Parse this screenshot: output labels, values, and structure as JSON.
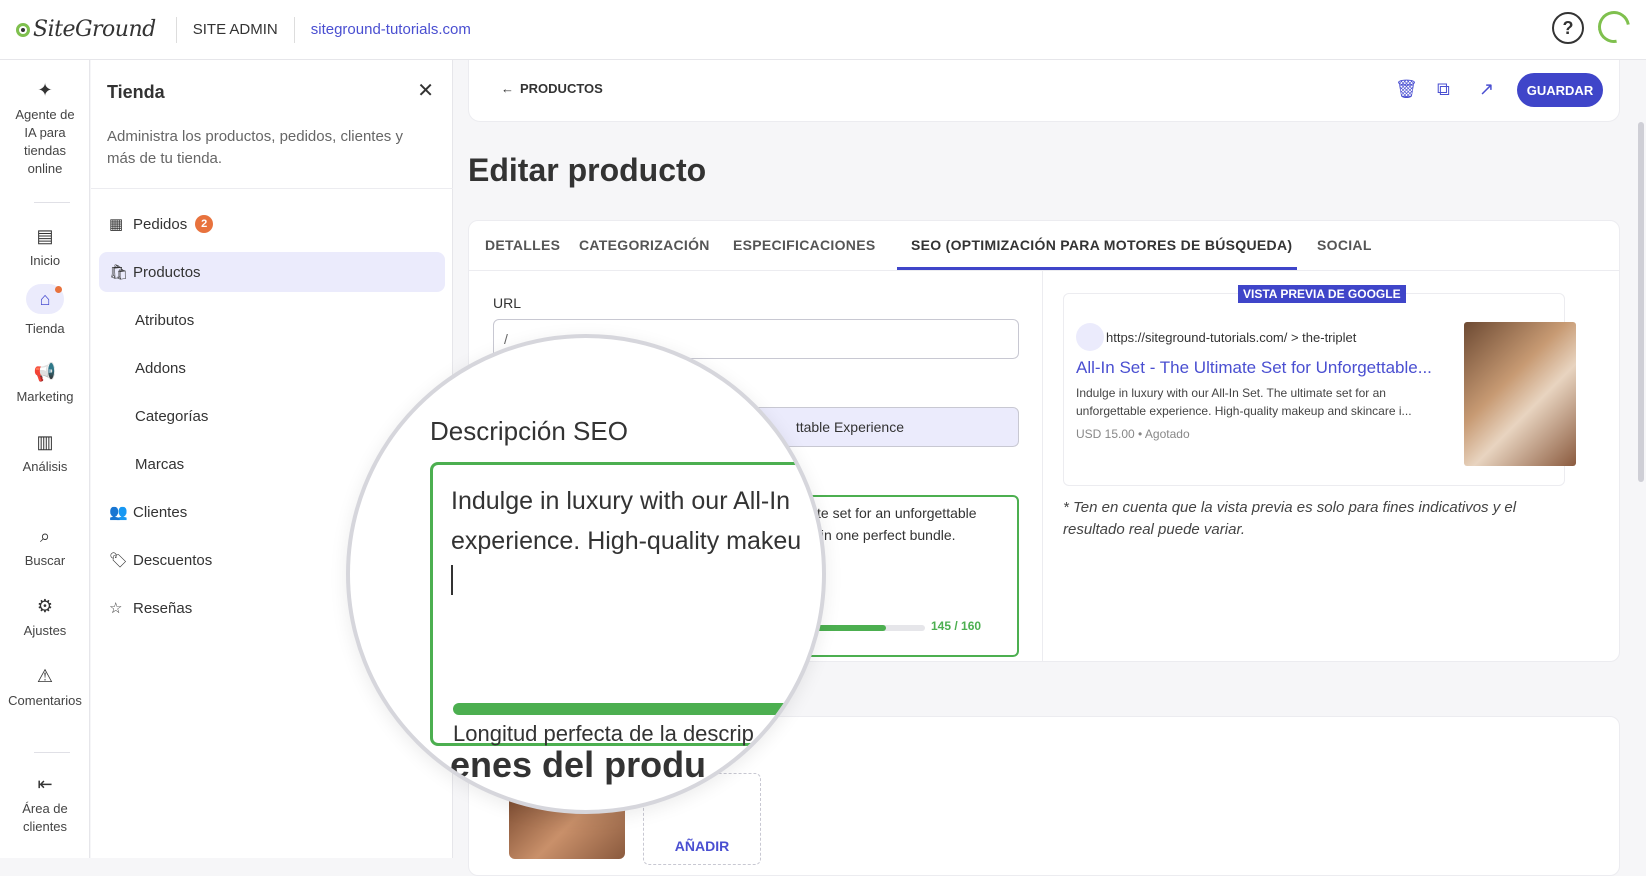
{
  "topbar": {
    "logo": "SiteGround",
    "site_admin": "SITE ADMIN",
    "domain": "siteground-tutorials.com",
    "help": "?"
  },
  "rail": {
    "ai_agent": "Agente de IA para tiendas online",
    "home": "Inicio",
    "store": "Tienda",
    "marketing": "Marketing",
    "analytics": "Análisis",
    "search": "Buscar",
    "settings": "Ajustes",
    "comments": "Comentarios",
    "client_area": "Área de clientes"
  },
  "panel": {
    "title": "Tienda",
    "description": "Administra los productos, pedidos, clientes y más de tu tienda.",
    "orders": "Pedidos",
    "orders_badge": "2",
    "products": "Productos",
    "attributes": "Atributos",
    "addons": "Addons",
    "categories": "Categorías",
    "brands": "Marcas",
    "customers": "Clientes",
    "discounts": "Descuentos",
    "reviews": "Reseñas"
  },
  "actionbar": {
    "back": "PRODUCTOS",
    "save": "GUARDAR"
  },
  "page_title": "Editar producto",
  "tabs": [
    "DETALLES",
    "CATEGORIZACIÓN",
    "ESPECIFICACIONES",
    "SEO (OPTIMIZACIÓN PARA MOTORES DE BÚSQUEDA)",
    "SOCIAL"
  ],
  "seo": {
    "url_label": "URL",
    "url_prefix": "/",
    "title_value_visible": "ttable Experience",
    "desc_visible_line1": "te set for an unforgettable",
    "desc_visible_line2": " in one perfect bundle.",
    "desc_progress": 0.906,
    "desc_count": "145 / 160"
  },
  "google_preview": {
    "badge": "VISTA PREVIA DE GOOGLE",
    "url": "https://siteground-tutorials.com/ > the-triplet",
    "link": "All-In Set - The Ultimate Set for Unforgettable...",
    "description": "Indulge in luxury with our All-In Set. The ultimate set for an unforgettable experience. High-quality makeup and skincare i...",
    "price": "USD 15.00 • Agotado",
    "note": "* Ten en cuenta que la vista previa es solo para fines indicativos y el resultado real puede variar."
  },
  "images": {
    "add": "AÑADIR"
  },
  "magnifier": {
    "label": "Descripción SEO",
    "line1": "Indulge in luxury with our All-In",
    "line2": "experience. High-quality makeu",
    "hint": "Longitud perfecta de la descrip",
    "heading": "enes del produ"
  }
}
